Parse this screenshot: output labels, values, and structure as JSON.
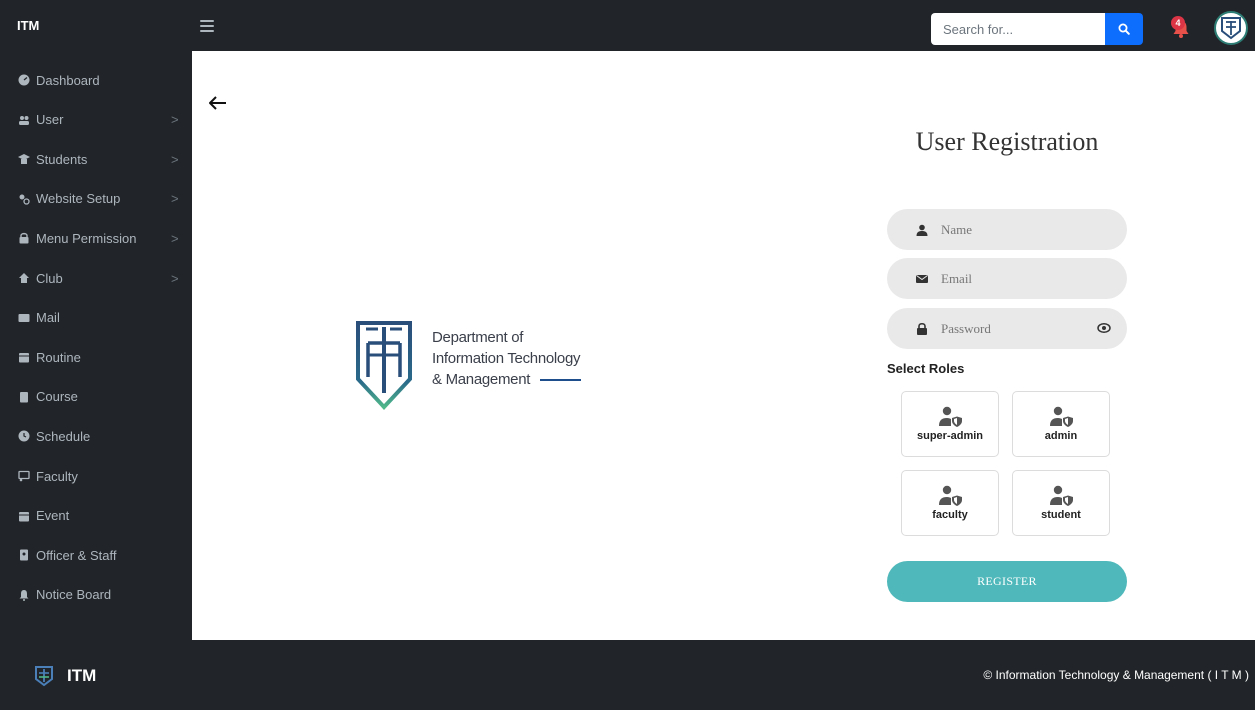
{
  "header": {
    "brand": "ITM",
    "search_placeholder": "Search for...",
    "notification_count": "4"
  },
  "sidebar": {
    "items": [
      {
        "label": "Dashboard",
        "icon": "dashboard-icon",
        "has_chevron": false
      },
      {
        "label": "User",
        "icon": "users-icon",
        "has_chevron": true
      },
      {
        "label": "Students",
        "icon": "graduate-icon",
        "has_chevron": true
      },
      {
        "label": "Website Setup",
        "icon": "gears-icon",
        "has_chevron": true
      },
      {
        "label": "Menu Permission",
        "icon": "lock-icon",
        "has_chevron": true
      },
      {
        "label": "Club",
        "icon": "club-icon",
        "has_chevron": true
      },
      {
        "label": "Mail",
        "icon": "mail-icon",
        "has_chevron": false
      },
      {
        "label": "Routine",
        "icon": "calendar-icon",
        "has_chevron": false
      },
      {
        "label": "Course",
        "icon": "book-icon",
        "has_chevron": false
      },
      {
        "label": "Schedule",
        "icon": "clock-icon",
        "has_chevron": false
      },
      {
        "label": "Faculty",
        "icon": "chalkboard-icon",
        "has_chevron": false
      },
      {
        "label": "Event",
        "icon": "calendar-icon",
        "has_chevron": false
      },
      {
        "label": "Officer & Staff",
        "icon": "id-badge-icon",
        "has_chevron": false
      },
      {
        "label": "Notice Board",
        "icon": "bell-icon",
        "has_chevron": false
      }
    ],
    "chevron": ">"
  },
  "logo": {
    "line1": "Department of",
    "line2": "Information Technology",
    "line3": "& Management"
  },
  "form": {
    "title": "User Registration",
    "name_placeholder": "Name",
    "email_placeholder": "Email",
    "password_placeholder": "Password",
    "roles_label": "Select Roles",
    "roles": [
      "super-admin",
      "admin",
      "faculty",
      "student"
    ],
    "submit_label": "REGISTER"
  },
  "footer": {
    "brand": "ITM",
    "copyright": "© Information Technology & Management ( I T M )"
  },
  "colors": {
    "sidebar_bg": "#212529",
    "accent_teal": "#4fb8ba",
    "search_button": "#0d6efd",
    "badge_red": "#dc3545"
  }
}
